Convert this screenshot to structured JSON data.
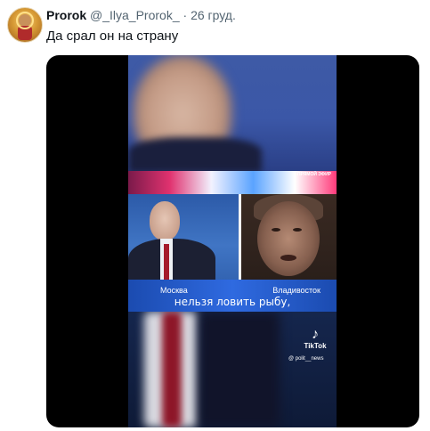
{
  "tweet": {
    "name": "Prorok",
    "handle": "@_Ilya_Prorok_",
    "separator": "·",
    "date": "26 груд.",
    "text": "Да срал он на страну"
  },
  "video": {
    "corner_label": "ПРЯМОЙ ЭФИР",
    "city_left": "Москва",
    "city_right": "Владивосток",
    "subtitle": "нельзя ловить рыбу,",
    "tiktok_icon": "♪",
    "tiktok_name": "TikTok",
    "tiktok_handle": "@ polit__news"
  },
  "icons": {
    "avatar": "avatar-icon",
    "tiktok": "tiktok-logo-icon"
  },
  "colors": {
    "text_primary": "#0f1419",
    "text_secondary": "#536471",
    "media_bg": "#000000"
  }
}
